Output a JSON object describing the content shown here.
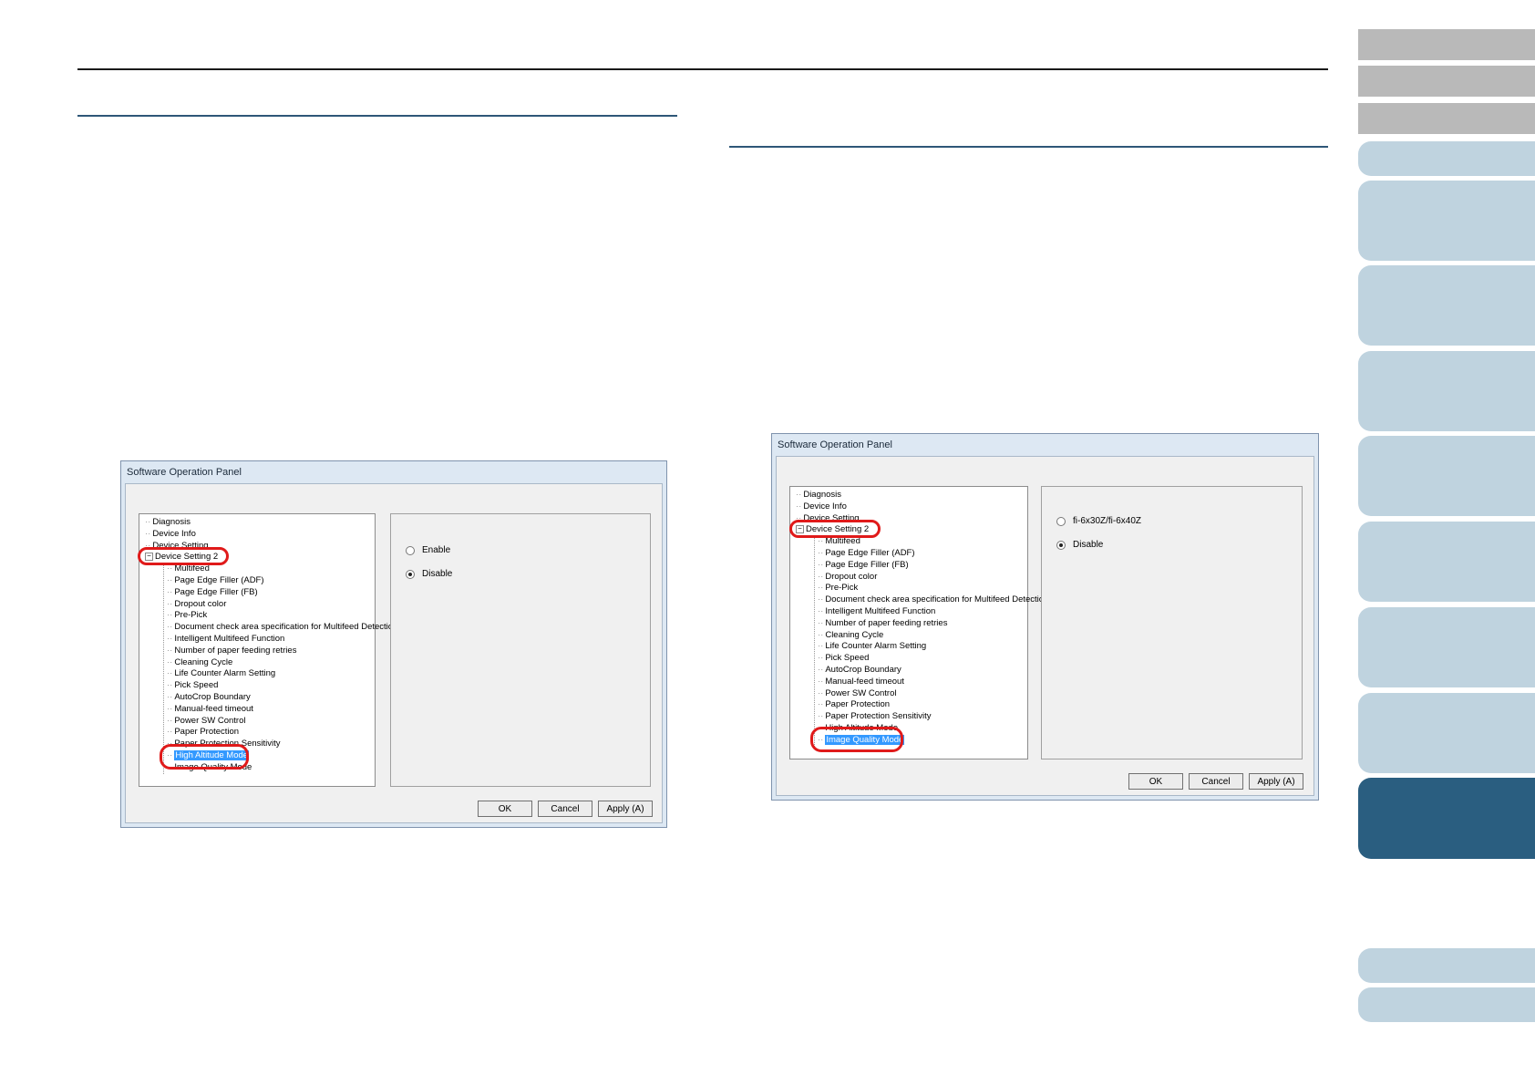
{
  "colors": {
    "header_rule": "#1a1a1a",
    "section_rule": "#2e5778",
    "nav_gray": "#b9b9b9",
    "nav_blue": "#bfd3df",
    "nav_active": "#2a5e80",
    "highlight": "#e01a1a",
    "selection": "#3399ff"
  },
  "nav_tabs": [
    {
      "style": "gray"
    },
    {
      "style": "gray"
    },
    {
      "style": "gray"
    },
    {
      "style": "blue"
    },
    {
      "style": "blue"
    },
    {
      "style": "blue"
    },
    {
      "style": "blue"
    },
    {
      "style": "blue"
    },
    {
      "style": "blue"
    },
    {
      "style": "blue"
    },
    {
      "style": "blue"
    },
    {
      "style": "active"
    },
    {
      "style": "blue"
    },
    {
      "style": "blue"
    }
  ],
  "left_dialog": {
    "title": "Software Operation Panel",
    "tree": [
      "Diagnosis",
      "Device Info",
      "Device Setting",
      "Device Setting 2",
      "Multifeed",
      "Page Edge Filler (ADF)",
      "Page Edge Filler (FB)",
      "Dropout color",
      "Pre-Pick",
      "Document check area specification for Multifeed Detection",
      "Intelligent Multifeed Function",
      "Number of paper feeding retries",
      "Cleaning Cycle",
      "Life Counter Alarm Setting",
      "Pick Speed",
      "AutoCrop Boundary",
      "Manual-feed timeout",
      "Power SW Control",
      "Paper Protection",
      "Paper Protection Sensitivity",
      "High Altitude Mode",
      "Image Quality Mode"
    ],
    "selected": "High Altitude Mode",
    "options": [
      {
        "label": "Enable",
        "checked": false
      },
      {
        "label": "Disable",
        "checked": true
      }
    ],
    "buttons": {
      "ok": "OK",
      "cancel": "Cancel",
      "apply": "Apply (A)"
    }
  },
  "right_dialog": {
    "title": "Software Operation Panel",
    "tree": [
      "Diagnosis",
      "Device Info",
      "Device Setting",
      "Device Setting 2",
      "Multifeed",
      "Page Edge Filler (ADF)",
      "Page Edge Filler (FB)",
      "Dropout color",
      "Pre-Pick",
      "Document check area specification for Multifeed Detection",
      "Intelligent Multifeed Function",
      "Number of paper feeding retries",
      "Cleaning Cycle",
      "Life Counter Alarm Setting",
      "Pick Speed",
      "AutoCrop Boundary",
      "Manual-feed timeout",
      "Power SW Control",
      "Paper Protection",
      "Paper Protection Sensitivity",
      "High Altitude Mode",
      "Image Quality Mode"
    ],
    "selected": "Image Quality Mode",
    "options": [
      {
        "label": "fi-6x30Z/fi-6x40Z",
        "checked": false
      },
      {
        "label": "Disable",
        "checked": true
      }
    ],
    "buttons": {
      "ok": "OK",
      "cancel": "Cancel",
      "apply": "Apply (A)"
    }
  }
}
